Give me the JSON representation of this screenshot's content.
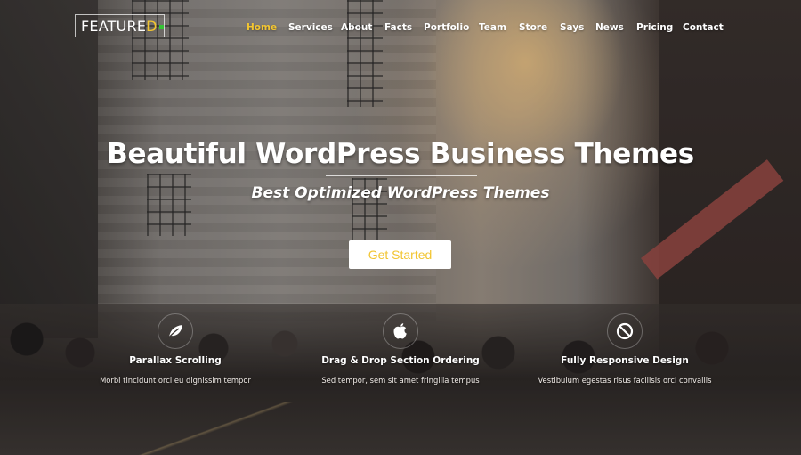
{
  "header": {
    "logo": {
      "text_main": "FEATURE",
      "text_accent": "D",
      "accent_color": "#f2c531",
      "dot_color": "#34c234"
    },
    "nav": [
      {
        "label": "Home",
        "active": true
      },
      {
        "label": "Services",
        "active": false
      },
      {
        "label": "About",
        "active": false
      },
      {
        "label": "Facts",
        "active": false
      },
      {
        "label": "Portfolio",
        "active": false
      },
      {
        "label": "Team",
        "active": false
      },
      {
        "label": "Store",
        "active": false
      },
      {
        "label": "Says",
        "active": false
      },
      {
        "label": "News",
        "active": false
      },
      {
        "label": "Pricing",
        "active": false
      },
      {
        "label": "Contact",
        "active": false
      }
    ]
  },
  "hero": {
    "headline": "Beautiful WordPress Business Themes",
    "subheadline": "Best Optimized WordPress Themes",
    "cta_label": "Get Started",
    "accent_color": "#f2c531"
  },
  "features": [
    {
      "icon": "leaf-icon",
      "title": "Parallax Scrolling",
      "description": "Morbi tincidunt orci eu dignissim tempor"
    },
    {
      "icon": "apple-icon",
      "title": "Drag & Drop Section Ordering",
      "description": "Sed tempor, sem sit amet fringilla tempus"
    },
    {
      "icon": "no-entry-icon",
      "title": "Fully Responsive Design",
      "description": "Vestibulum egestas risus facilisis orci convallis"
    }
  ]
}
